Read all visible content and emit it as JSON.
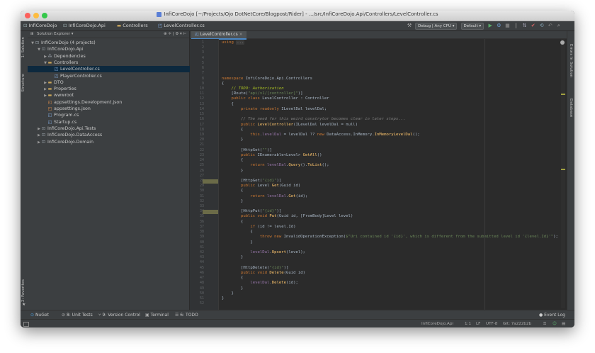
{
  "window": {
    "title": "InfiCoreDojo [~/Projects/Ojo DotNetCore/Blogpost/Rider] - .../src/InfiCoreDojo.Api/Controllers/LevelController.cs",
    "colors": {
      "close": "#fc605c",
      "minimize": "#fdbc40",
      "zoom": "#34c84a"
    }
  },
  "breadcrumbs": [
    "InfiCoreDojo",
    "InfiCoreDojo.Api",
    "Controllers",
    "LevelController.cs"
  ],
  "toolbar": {
    "config": "Debug | Any CPU",
    "profile": "Default",
    "icons": [
      "run-icon",
      "debug-icon",
      "stop-icon",
      "vcs-icon",
      "search-icon"
    ]
  },
  "side_tools": {
    "left_top": [
      "1: Solution",
      "Structure"
    ],
    "left_bottom": "2: Favorites",
    "right": [
      "Errors In Solution",
      "Database"
    ]
  },
  "explorer": {
    "header": "Solution Explorer",
    "items": [
      {
        "label": "InfiCoreDojo (4 projects)",
        "depth": 0,
        "icon": "solution-icon",
        "expanded": true
      },
      {
        "label": "InfiCoreDojo.Api",
        "depth": 1,
        "icon": "project-icon",
        "expanded": true
      },
      {
        "label": "Dependencies",
        "depth": 2,
        "icon": "dependencies-icon",
        "expanded": false
      },
      {
        "label": "Controllers",
        "depth": 2,
        "icon": "folder-icon",
        "expanded": true
      },
      {
        "label": "LevelController.cs",
        "depth": 3,
        "icon": "csharp-file-icon",
        "selected": true
      },
      {
        "label": "PlayerController.cs",
        "depth": 3,
        "icon": "csharp-file-icon"
      },
      {
        "label": "DTO",
        "depth": 2,
        "icon": "folder-icon",
        "expanded": false
      },
      {
        "label": "Properties",
        "depth": 2,
        "icon": "folder-icon",
        "expanded": false
      },
      {
        "label": "wwwroot",
        "depth": 2,
        "icon": "folder-icon",
        "expanded": false
      },
      {
        "label": "appsettings.Development.json",
        "depth": 2,
        "icon": "json-file-icon"
      },
      {
        "label": "appsettings.json",
        "depth": 2,
        "icon": "json-file-icon"
      },
      {
        "label": "Program.cs",
        "depth": 2,
        "icon": "csharp-file-icon"
      },
      {
        "label": "Startup.cs",
        "depth": 2,
        "icon": "csharp-file-icon"
      },
      {
        "label": "InfiCoreDojo.Api.Tests",
        "depth": 1,
        "icon": "project-icon",
        "expanded": false
      },
      {
        "label": "InfiCoreDojo.DataAccess",
        "depth": 1,
        "icon": "project-icon",
        "expanded": false
      },
      {
        "label": "InfiCoreDojo.Domain",
        "depth": 1,
        "icon": "project-icon",
        "expanded": false
      }
    ]
  },
  "editor": {
    "tab": "LevelController.cs",
    "line_numbers": [
      "1",
      "2",
      "3",
      "4",
      "5",
      "6",
      "7",
      "8",
      "9",
      "10",
      "11",
      "12",
      "13",
      "14",
      "15",
      "16",
      "17",
      "18",
      "19",
      "20",
      "21",
      "22",
      "23",
      "24",
      "25",
      "26",
      "27",
      "28",
      "29",
      "30",
      "31",
      "32",
      "33",
      "34",
      "35",
      "36",
      "37",
      "38",
      "39",
      "40",
      "41",
      "42",
      "43",
      "44",
      "45",
      "46",
      "47",
      "48",
      "49",
      "50",
      "51",
      "52"
    ],
    "lines": [
      "using ...",
      "",
      "",
      "",
      "",
      "",
      "",
      "namespace InfiCoreDojo.Api.Controllers",
      "{",
      "    // TODO: Authorization",
      "    [Route(\"api/v1/[controller]\")]",
      "    public class LevelController : Controller",
      "    {",
      "        private readonly ILevelDal levelDal;",
      "",
      "        // The need for this weird constrytor becomes clear in later steps...",
      "        public LevelController(ILevelDal levelDal = null)",
      "        {",
      "            this.levelDal = levelDal ?? new DataAccess.InMemory.InMemoryLevelDal();",
      "        }",
      "",
      "        [HttpGet(\"\")]",
      "        public IEnumerable<Level> GetAll()",
      "        {",
      "            return levelDal.Query().ToList();",
      "        }",
      "",
      "        [HttpGet(\"{id}\")]",
      "        public Level Get(Guid id)",
      "        {",
      "            return levelDal.Get(id);",
      "        }",
      "",
      "        [HttpPut(\"{id}\")]",
      "        public void Put(Guid id, [FromBody]Level level)",
      "        {",
      "            if (id != level.Id)",
      "            {",
      "                throw new InvalidOperationException($\"Uri contained id '{id}', which is different from the submitted level id '{level.Id}'\");",
      "            }",
      "",
      "            levelDal.Upsert(level);",
      "        }",
      "",
      "        [HttpDelete(\"{id}\")]",
      "        public void Delete(Guid id)",
      "        {",
      "            levelDal.Delete(id);",
      "        }",
      "    }",
      "}",
      ""
    ]
  },
  "tool_windows": [
    {
      "label": "NuGet",
      "icon": "nuget-icon"
    },
    {
      "label": "8: Unit Tests",
      "icon": "unit-tests-icon"
    },
    {
      "label": "9: Version Control",
      "icon": "vcs-icon"
    },
    {
      "label": "Terminal",
      "icon": "terminal-icon"
    },
    {
      "label": "6: TODO",
      "icon": "todo-icon"
    }
  ],
  "event_log": "Event Log",
  "status": {
    "project": "InfiCoreDojo.Api",
    "position": "1:1",
    "line_ending": "LF",
    "encoding": "UTF-8",
    "git": "Git: 7a222b2b"
  }
}
